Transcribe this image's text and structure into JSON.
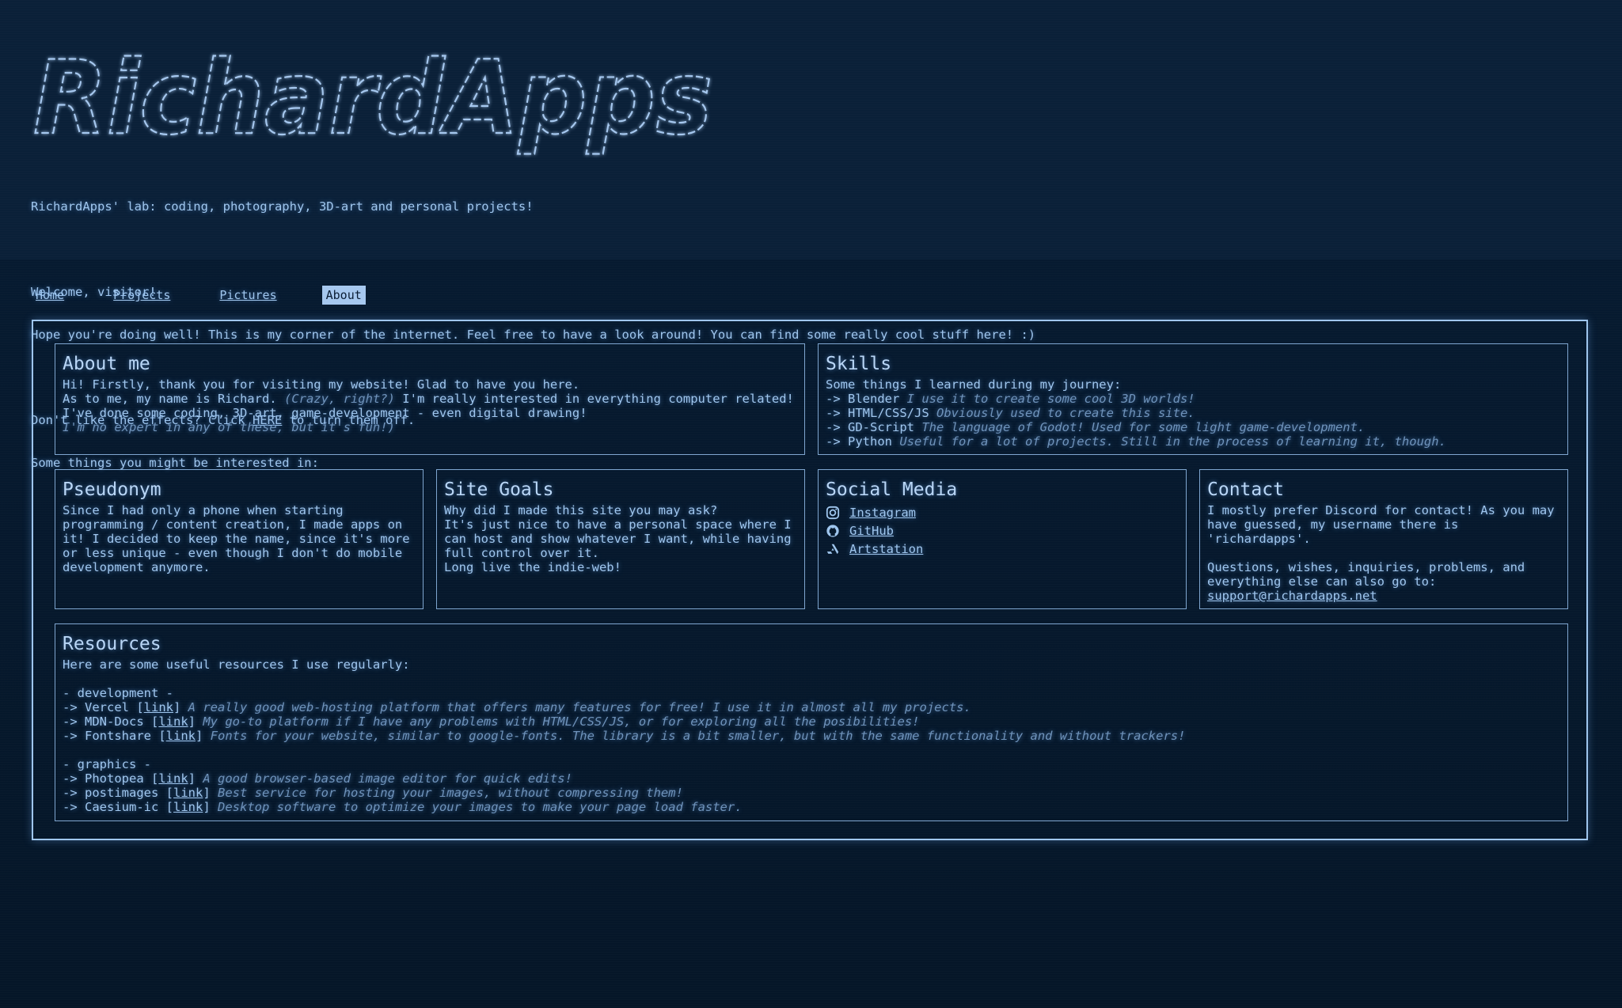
{
  "logo": {
    "text": "RichardApps"
  },
  "intro": {
    "tagline": "RichardApps' lab: coding, photography, 3D-art and personal projects!",
    "welcome": "Welcome, visitor!",
    "hope": "Hope you're doing well! This is my corner of the internet. Feel free to have a look around! You can find some really cool stuff here! :)",
    "effects_pre": "Don't like the effects? Click ",
    "effects_link": "HERE",
    "effects_post": " to turn them off.",
    "interest": "Some things you might be interested in:"
  },
  "nav": {
    "items": [
      {
        "label": "Home"
      },
      {
        "label": "Projects"
      },
      {
        "label": "Pictures"
      },
      {
        "label": "About"
      }
    ]
  },
  "about": {
    "title": "About me",
    "line1": "Hi! Firstly, thank you for visiting my website! Glad to have you here.",
    "line2_pre": "As to me, my name is Richard. ",
    "line2_em": "(Crazy, right?)",
    "line2_post": " I'm really interested in everything computer related!",
    "line3": "I've done some coding, 3D-art, game-development - even digital drawing!",
    "line4": "I'm no expert in any of these, but it's fun!)"
  },
  "skills": {
    "title": "Skills",
    "intro": "Some things I learned during my journey:",
    "items": [
      {
        "name": "-> Blender",
        "desc": "I use it to create some cool 3D worlds!"
      },
      {
        "name": "-> HTML/CSS/JS",
        "desc": "Obviously used to create this site."
      },
      {
        "name": "-> GD-Script",
        "desc": "The language of Godot! Used for some light game-development."
      },
      {
        "name": "-> Python",
        "desc": "Useful for a lot of projects. Still in the process of learning it, though."
      }
    ]
  },
  "pseudonym": {
    "title": "Pseudonym",
    "l1": "Since I had only a phone when starting",
    "l2": "programming / content creation, I made apps on",
    "l3": "it! I decided to keep the name, since it's more",
    "l4": "or less unique - even though I don't do mobile",
    "l5": "development anymore."
  },
  "goals": {
    "title": "Site Goals",
    "l1": "Why did I made this site you may ask?",
    "l2": "It's just nice to have a personal space where I",
    "l3": "can host and show whatever I want, while having",
    "l4": "full control over it.",
    "l5": "Long live the indie-web!"
  },
  "social": {
    "title": "Social Media",
    "items": [
      {
        "label": "Instagram",
        "icon": "instagram-icon"
      },
      {
        "label": "GitHub",
        "icon": "github-icon"
      },
      {
        "label": "Artstation",
        "icon": "artstation-icon"
      }
    ]
  },
  "contact": {
    "title": "Contact",
    "l1": "I mostly prefer Discord for contact! As you may",
    "l2": "have guessed, my username there is",
    "l3": "'richardapps'.",
    "l4": "Questions, wishes, inquiries, problems, and",
    "l5": "everything else can also go to:",
    "email": "support@richardapps.net"
  },
  "resources": {
    "title": "Resources",
    "intro": "Here are some useful resources I use regularly:",
    "dev_header": "- development -",
    "dev": [
      {
        "name": "-> Vercel",
        "link": "link",
        "desc": "A really good web-hosting platform that offers many features for free! I use it in almost all my projects."
      },
      {
        "name": "-> MDN-Docs",
        "link": "link",
        "desc": "My go-to platform if I have any problems with HTML/CSS/JS, or for exploring all the posibilities!"
      },
      {
        "name": "-> Fontshare",
        "link": "link",
        "desc": "Fonts for your website, similar to google-fonts. The library is a bit smaller, but with the same functionality and without trackers!"
      }
    ],
    "gfx_header": "- graphics -",
    "gfx": [
      {
        "name": "-> Photopea",
        "link": "link",
        "desc": "A good browser-based image editor for quick edits!"
      },
      {
        "name": "-> postimages",
        "link": "link",
        "desc": "Best service for hosting your images, without compressing them!"
      },
      {
        "name": "-> Caesium-ic",
        "link": "link",
        "desc": "Desktop software to optimize your images to make your page load faster."
      }
    ]
  },
  "colors": {
    "background": "#061729",
    "text": "#9fc6ee",
    "accent": "#a6c8ef",
    "muted": "#6f93bb"
  }
}
